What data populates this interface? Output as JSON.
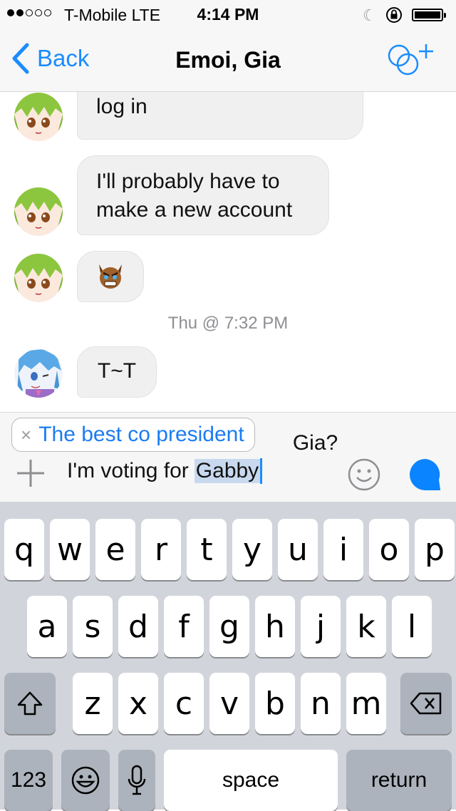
{
  "status_bar": {
    "carrier": "T-Mobile  LTE",
    "time": "4:14 PM",
    "signal_bars_filled": 2,
    "signal_bars_total": 5
  },
  "nav": {
    "back_label": "Back",
    "title": "Emoi, Gia",
    "accent_color": "#1a8cff"
  },
  "messages": [
    {
      "text": "Ugh roblox won't let me log in",
      "visible_text": "log in",
      "sender": "gia"
    },
    {
      "text": "I'll probably have to make a new account",
      "sender": "gia"
    },
    {
      "type": "emoji",
      "icon": "angry-bull-emoji",
      "sender": "gia"
    },
    {
      "type": "timestamp",
      "text": "Thu @ 7:32 PM"
    },
    {
      "text": "T~T",
      "sender": "emoi"
    }
  ],
  "composer": {
    "hidden_text_end": "Gia?",
    "suggestion": "The best co president",
    "input_text": "I'm voting for",
    "selected_text": "Gabby"
  },
  "keyboard": {
    "row1": [
      "q",
      "w",
      "e",
      "r",
      "t",
      "y",
      "u",
      "i",
      "o",
      "p"
    ],
    "row2": [
      "a",
      "s",
      "d",
      "f",
      "g",
      "h",
      "j",
      "k",
      "l"
    ],
    "row3": [
      "z",
      "x",
      "c",
      "v",
      "b",
      "n",
      "m"
    ],
    "numbers_label": "123",
    "space_label": "space",
    "return_label": "return"
  }
}
